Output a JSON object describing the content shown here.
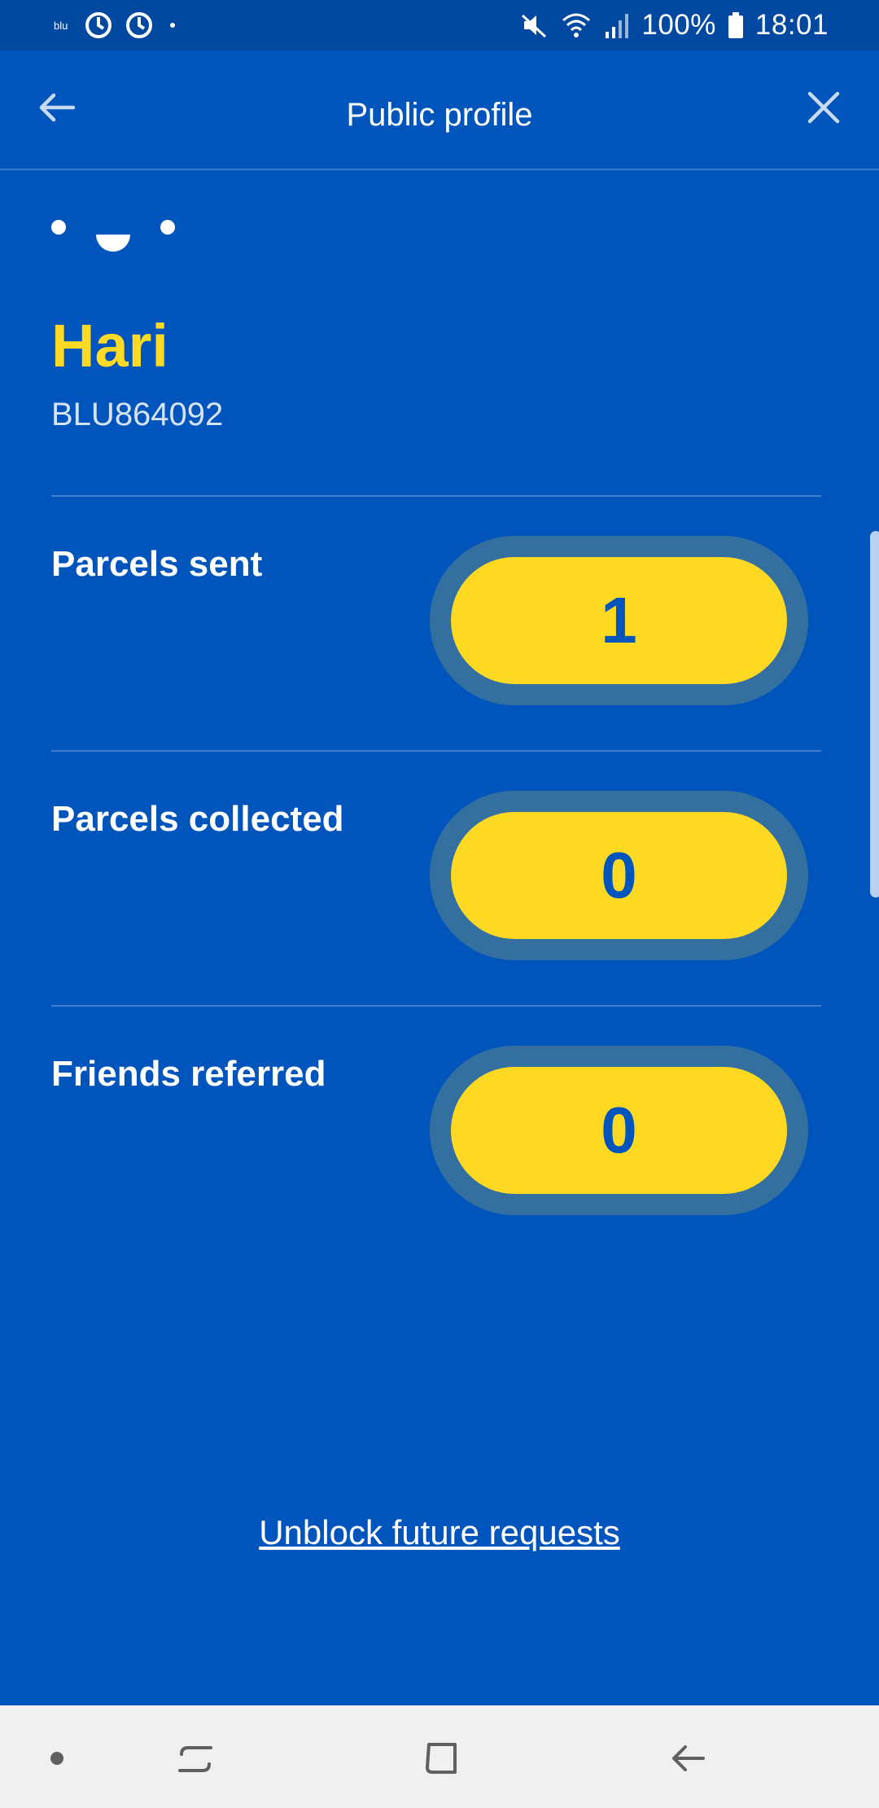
{
  "status_bar": {
    "carrier": "blu",
    "battery": "100%",
    "time": "18:01"
  },
  "header": {
    "title": "Public profile",
    "back_icon": "arrow-left-icon",
    "close_icon": "close-icon"
  },
  "profile": {
    "name": "Hari",
    "id": "BLU864092"
  },
  "stats": [
    {
      "label": "Parcels sent",
      "value": "1"
    },
    {
      "label": "Parcels collected",
      "value": "0"
    },
    {
      "label": "Friends referred",
      "value": "0"
    }
  ],
  "actions": {
    "unblock_label": "Unblock future requests"
  },
  "colors": {
    "background": "#0055bc",
    "status_bar": "#0148a1",
    "accent_yellow": "#fed925",
    "pill_ring": "#336f9f",
    "nav_bar": "#f0f0f0"
  }
}
